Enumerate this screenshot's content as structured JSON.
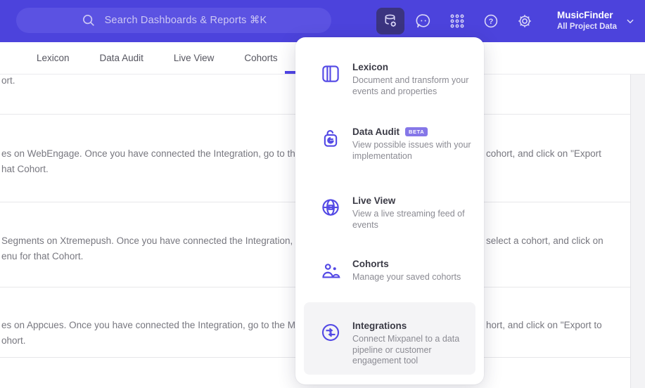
{
  "topnav": {
    "search": {
      "placeholder": "Search Dashboards & Reports ⌘K"
    },
    "help_glyph": "?",
    "project": {
      "name": "MusicFinder",
      "subtitle": "All Project Data"
    }
  },
  "tabs": [
    {
      "label": "Lexicon"
    },
    {
      "label": "Data Audit"
    },
    {
      "label": "Live View"
    },
    {
      "label": "Cohorts"
    }
  ],
  "menu": {
    "items": [
      {
        "icon": "book-icon",
        "title": "Lexicon",
        "desc": "Document and transform your events and properties"
      },
      {
        "icon": "lock-icon",
        "title": "Data Audit",
        "badge": "BETA",
        "desc": "View possible issues with your implementation"
      },
      {
        "icon": "globe-icon",
        "title": "Live View",
        "desc": "View a live streaming feed of events"
      },
      {
        "icon": "users-icon",
        "title": "Cohorts",
        "desc": "Manage your saved cohorts"
      },
      {
        "icon": "sync-icon",
        "title": "Integrations",
        "desc": "Connect Mixpanel to a data pipeline or customer engagement tool"
      }
    ]
  },
  "background": {
    "rows": [
      {
        "left1": "ort.",
        "left2": "",
        "right": ""
      },
      {
        "left1": "es on WebEngage. Once you have connected the Integration, go to the",
        "left2": "hat Cohort.",
        "right": "cohort, and click on \"Export"
      },
      {
        "left1": "Segments on Xtremepush. Once you have connected the Integration,",
        "left2": "enu for that Cohort.",
        "right": "select a cohort, and click on"
      },
      {
        "left1": "es on Appcues. Once you have connected the Integration, go to the M",
        "left2": "ohort.",
        "right": "hort, and click on \"Export to"
      }
    ]
  },
  "colors": {
    "nav_purple": "#4c43dc",
    "search_pill": "#5b52e2",
    "active_icon_bg": "#3b3480",
    "accent": "#4f44e8",
    "menu_icon": "#5349e5",
    "beta_badge": "#8577e8",
    "body_text": "#77777f"
  }
}
